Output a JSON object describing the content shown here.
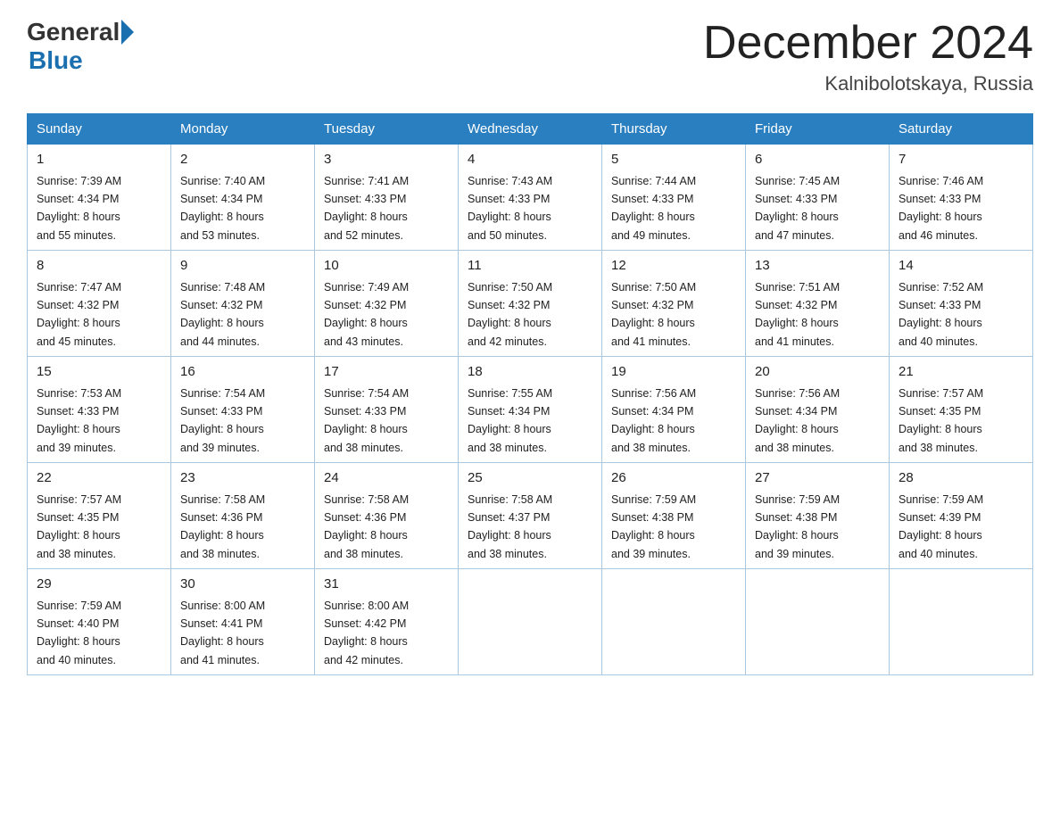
{
  "header": {
    "logo": {
      "general": "General",
      "blue": "Blue"
    },
    "title": "December 2024",
    "location": "Kalnibolotskaya, Russia"
  },
  "weekdays": [
    "Sunday",
    "Monday",
    "Tuesday",
    "Wednesday",
    "Thursday",
    "Friday",
    "Saturday"
  ],
  "weeks": [
    [
      {
        "day": "1",
        "sunrise": "7:39 AM",
        "sunset": "4:34 PM",
        "daylight": "8 hours and 55 minutes."
      },
      {
        "day": "2",
        "sunrise": "7:40 AM",
        "sunset": "4:34 PM",
        "daylight": "8 hours and 53 minutes."
      },
      {
        "day": "3",
        "sunrise": "7:41 AM",
        "sunset": "4:33 PM",
        "daylight": "8 hours and 52 minutes."
      },
      {
        "day": "4",
        "sunrise": "7:43 AM",
        "sunset": "4:33 PM",
        "daylight": "8 hours and 50 minutes."
      },
      {
        "day": "5",
        "sunrise": "7:44 AM",
        "sunset": "4:33 PM",
        "daylight": "8 hours and 49 minutes."
      },
      {
        "day": "6",
        "sunrise": "7:45 AM",
        "sunset": "4:33 PM",
        "daylight": "8 hours and 47 minutes."
      },
      {
        "day": "7",
        "sunrise": "7:46 AM",
        "sunset": "4:33 PM",
        "daylight": "8 hours and 46 minutes."
      }
    ],
    [
      {
        "day": "8",
        "sunrise": "7:47 AM",
        "sunset": "4:32 PM",
        "daylight": "8 hours and 45 minutes."
      },
      {
        "day": "9",
        "sunrise": "7:48 AM",
        "sunset": "4:32 PM",
        "daylight": "8 hours and 44 minutes."
      },
      {
        "day": "10",
        "sunrise": "7:49 AM",
        "sunset": "4:32 PM",
        "daylight": "8 hours and 43 minutes."
      },
      {
        "day": "11",
        "sunrise": "7:50 AM",
        "sunset": "4:32 PM",
        "daylight": "8 hours and 42 minutes."
      },
      {
        "day": "12",
        "sunrise": "7:50 AM",
        "sunset": "4:32 PM",
        "daylight": "8 hours and 41 minutes."
      },
      {
        "day": "13",
        "sunrise": "7:51 AM",
        "sunset": "4:32 PM",
        "daylight": "8 hours and 41 minutes."
      },
      {
        "day": "14",
        "sunrise": "7:52 AM",
        "sunset": "4:33 PM",
        "daylight": "8 hours and 40 minutes."
      }
    ],
    [
      {
        "day": "15",
        "sunrise": "7:53 AM",
        "sunset": "4:33 PM",
        "daylight": "8 hours and 39 minutes."
      },
      {
        "day": "16",
        "sunrise": "7:54 AM",
        "sunset": "4:33 PM",
        "daylight": "8 hours and 39 minutes."
      },
      {
        "day": "17",
        "sunrise": "7:54 AM",
        "sunset": "4:33 PM",
        "daylight": "8 hours and 38 minutes."
      },
      {
        "day": "18",
        "sunrise": "7:55 AM",
        "sunset": "4:34 PM",
        "daylight": "8 hours and 38 minutes."
      },
      {
        "day": "19",
        "sunrise": "7:56 AM",
        "sunset": "4:34 PM",
        "daylight": "8 hours and 38 minutes."
      },
      {
        "day": "20",
        "sunrise": "7:56 AM",
        "sunset": "4:34 PM",
        "daylight": "8 hours and 38 minutes."
      },
      {
        "day": "21",
        "sunrise": "7:57 AM",
        "sunset": "4:35 PM",
        "daylight": "8 hours and 38 minutes."
      }
    ],
    [
      {
        "day": "22",
        "sunrise": "7:57 AM",
        "sunset": "4:35 PM",
        "daylight": "8 hours and 38 minutes."
      },
      {
        "day": "23",
        "sunrise": "7:58 AM",
        "sunset": "4:36 PM",
        "daylight": "8 hours and 38 minutes."
      },
      {
        "day": "24",
        "sunrise": "7:58 AM",
        "sunset": "4:36 PM",
        "daylight": "8 hours and 38 minutes."
      },
      {
        "day": "25",
        "sunrise": "7:58 AM",
        "sunset": "4:37 PM",
        "daylight": "8 hours and 38 minutes."
      },
      {
        "day": "26",
        "sunrise": "7:59 AM",
        "sunset": "4:38 PM",
        "daylight": "8 hours and 39 minutes."
      },
      {
        "day": "27",
        "sunrise": "7:59 AM",
        "sunset": "4:38 PM",
        "daylight": "8 hours and 39 minutes."
      },
      {
        "day": "28",
        "sunrise": "7:59 AM",
        "sunset": "4:39 PM",
        "daylight": "8 hours and 40 minutes."
      }
    ],
    [
      {
        "day": "29",
        "sunrise": "7:59 AM",
        "sunset": "4:40 PM",
        "daylight": "8 hours and 40 minutes."
      },
      {
        "day": "30",
        "sunrise": "8:00 AM",
        "sunset": "4:41 PM",
        "daylight": "8 hours and 41 minutes."
      },
      {
        "day": "31",
        "sunrise": "8:00 AM",
        "sunset": "4:42 PM",
        "daylight": "8 hours and 42 minutes."
      },
      null,
      null,
      null,
      null
    ]
  ],
  "labels": {
    "sunrise": "Sunrise:",
    "sunset": "Sunset:",
    "daylight": "Daylight:"
  }
}
